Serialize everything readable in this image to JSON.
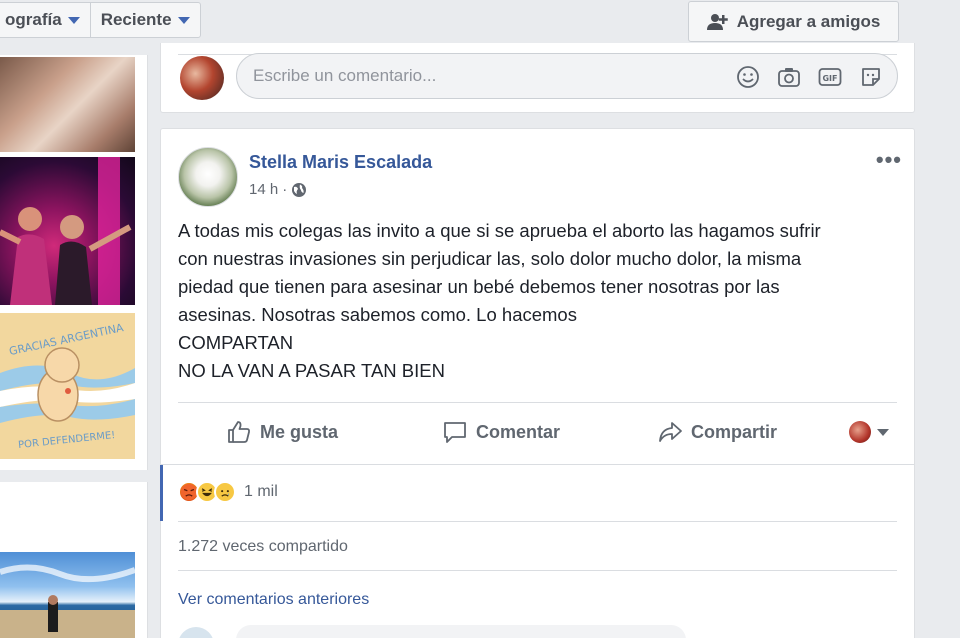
{
  "filter_bar": {
    "tab_photography": "ografía",
    "tab_recent": "Reciente"
  },
  "header": {
    "add_friend_label": "Agregar a amigos"
  },
  "previous_post": {
    "comment_placeholder": "Escribe un comentario..."
  },
  "post": {
    "author": "Stella Maris Escalada",
    "timestamp": "14 h",
    "separator": "·",
    "text": "A todas mis colegas las invito a que si se aprueba el aborto las hagamos sufrir\ncon nuestras invasiones sin perjudicar las, solo dolor mucho dolor, la misma\npiedad que tienen para asesinar un bebé debemos tener nosotras por las\nasesinas. Nosotras sabemos como. Lo hacemos\nCOMPARTAN\nNO LA VAN A PASAR TAN BIEN",
    "actions": {
      "like": "Me gusta",
      "comment": "Comentar",
      "share": "Compartir"
    },
    "reaction_count": "1 mil",
    "share_count": "1.272 veces compartido",
    "view_previous_comments": "Ver comentarios anteriores"
  },
  "photo_badge": {
    "top_text": "GRACIAS ARGENTINA",
    "bottom_text": "POR DEFENDERME!"
  },
  "colors": {
    "link_blue": "#365899",
    "accent_blue": "#4267b2",
    "page_bg": "#e9ebee"
  }
}
